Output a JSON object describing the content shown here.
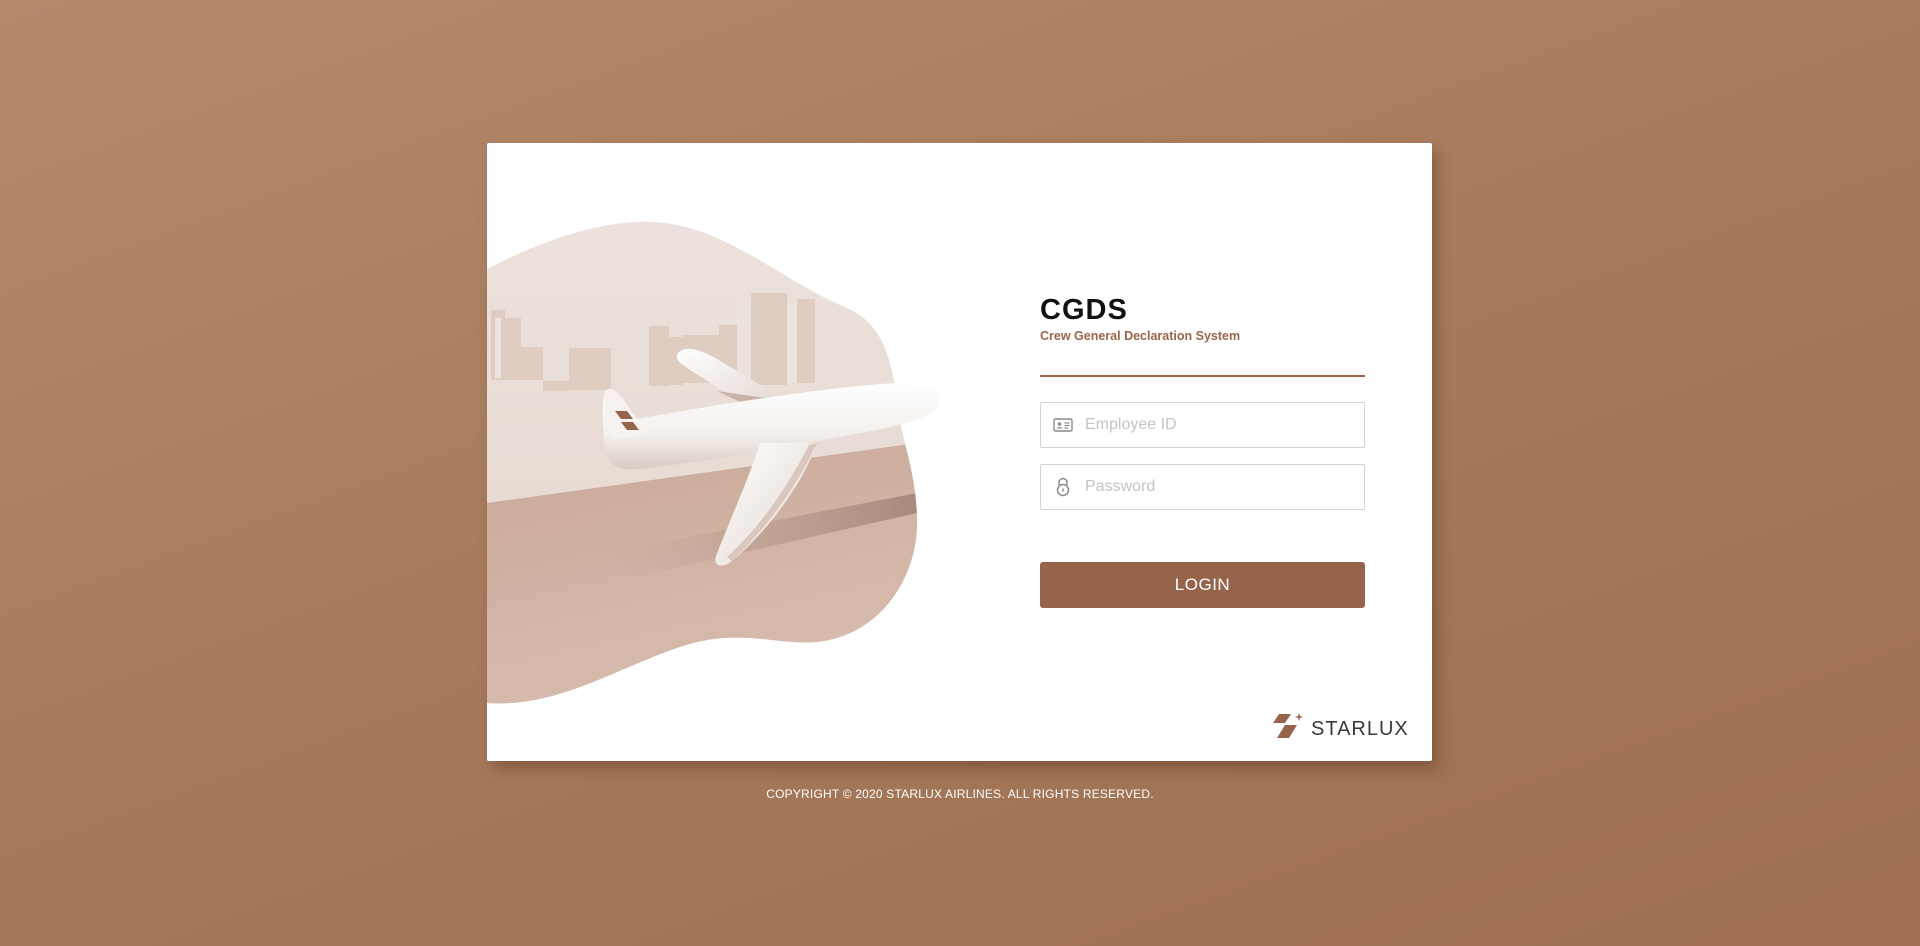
{
  "login": {
    "app_code": "CGDS",
    "app_name": "Crew General Declaration System",
    "employee_id_placeholder": "Employee ID",
    "password_placeholder": "Password",
    "login_label": "LOGIN"
  },
  "brand": {
    "logo_text": "STARLUX",
    "accent_color": "#96644a"
  },
  "footer": {
    "copyright": "COPYRIGHT © 2020 STARLUX AIRLINES. ALL RIGHTS RESERVED."
  },
  "icons": {
    "employee": "id-card-icon",
    "password": "lock-icon",
    "logo": "starlux-logo-icon"
  }
}
